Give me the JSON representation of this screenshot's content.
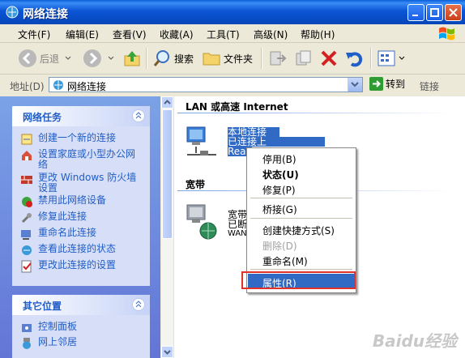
{
  "window": {
    "title": "网络连接",
    "title_icon": "network-connections-icon"
  },
  "menubar": {
    "items": [
      "文件(F)",
      "编辑(E)",
      "查看(V)",
      "收藏(A)",
      "工具(T)",
      "高级(N)",
      "帮助(H)"
    ]
  },
  "toolbar": {
    "back": "后退",
    "search": "搜索",
    "folders": "文件夹"
  },
  "address": {
    "label": "地址(D)",
    "value": "网络连接",
    "go": "转到",
    "links": "链接"
  },
  "tasks_panel": {
    "title": "网络任务",
    "items": [
      {
        "label": "创建一个新的连接",
        "icon": "new-connection-icon"
      },
      {
        "label": "设置家庭或小型办公网络",
        "icon": "home-network-icon"
      },
      {
        "label": "更改 Windows 防火墙设置",
        "icon": "firewall-icon"
      },
      {
        "label": "禁用此网络设备",
        "icon": "disable-icon"
      },
      {
        "label": "修复此连接",
        "icon": "repair-icon"
      },
      {
        "label": "重命名此连接",
        "icon": "rename-icon"
      },
      {
        "label": "查看此连接的状态",
        "icon": "status-icon"
      },
      {
        "label": "更改此连接的设置",
        "icon": "settings-icon"
      }
    ]
  },
  "other_panel": {
    "title": "其它位置",
    "items": [
      {
        "label": "控制面板",
        "icon": "control-panel-icon"
      },
      {
        "label": "网上邻居",
        "icon": "network-places-icon"
      }
    ]
  },
  "main": {
    "group_lan": "LAN 或高速 Internet",
    "lan_conn": {
      "name": "本地连接",
      "status": "已连接上",
      "device": "Rea"
    },
    "group_broadband": "宽带",
    "broadband_conn": {
      "name": "宽带",
      "status": "已断",
      "device": "WAN"
    }
  },
  "context_menu": {
    "items": [
      {
        "label": "停用(B)"
      },
      {
        "label": "状态(U)",
        "bold": true
      },
      {
        "label": "修复(P)"
      },
      {
        "label": "桥接(G)"
      },
      {
        "label": "创建快捷方式(S)"
      },
      {
        "label": "删除(D)",
        "disabled": true
      },
      {
        "label": "重命名(M)"
      },
      {
        "label": "属性(R)",
        "highlighted": true
      }
    ]
  },
  "watermark": "Baidu经验",
  "colors": {
    "title_bar": "#0b55d6",
    "task_link": "#215dc6",
    "selection": "#316ac5",
    "highlight_box": "#e0312b"
  }
}
